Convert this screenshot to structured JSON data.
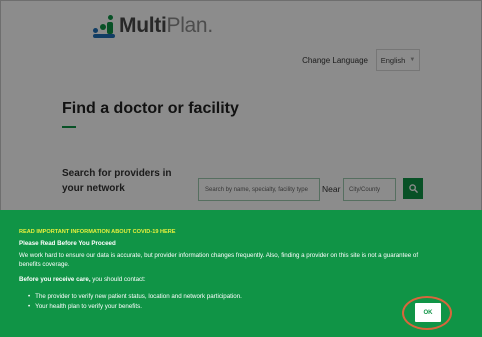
{
  "brand": {
    "name_bold": "Multi",
    "name_light": "Plan",
    "suffix": "."
  },
  "language": {
    "label": "Change Language",
    "selected": "English"
  },
  "page": {
    "title": "Find a doctor or facility"
  },
  "search": {
    "heading": "Search for providers in your network",
    "query_placeholder": "Search by name, specialty, facility type",
    "near_label": "Near",
    "location_placeholder": "City/County"
  },
  "banner": {
    "alert": "READ IMPORTANT INFORMATION ABOUT COVID-19 HERE",
    "heading": "Please Read Before You Proceed",
    "body": "We work hard to ensure our data is accurate, but provider information changes frequently. Also, finding a provider on this site is not a guarantee of benefits coverage.",
    "contact_bold": "Before you receive care,",
    "contact_rest": " you should contact:",
    "items": [
      "The provider to verify new patient status, location and network participation.",
      "Your health plan to verify your benefits."
    ],
    "ok_label": "OK"
  },
  "colors": {
    "brand_green": "#109446",
    "alert_yellow": "#e6f03c",
    "highlight_ring": "#d9663c"
  }
}
